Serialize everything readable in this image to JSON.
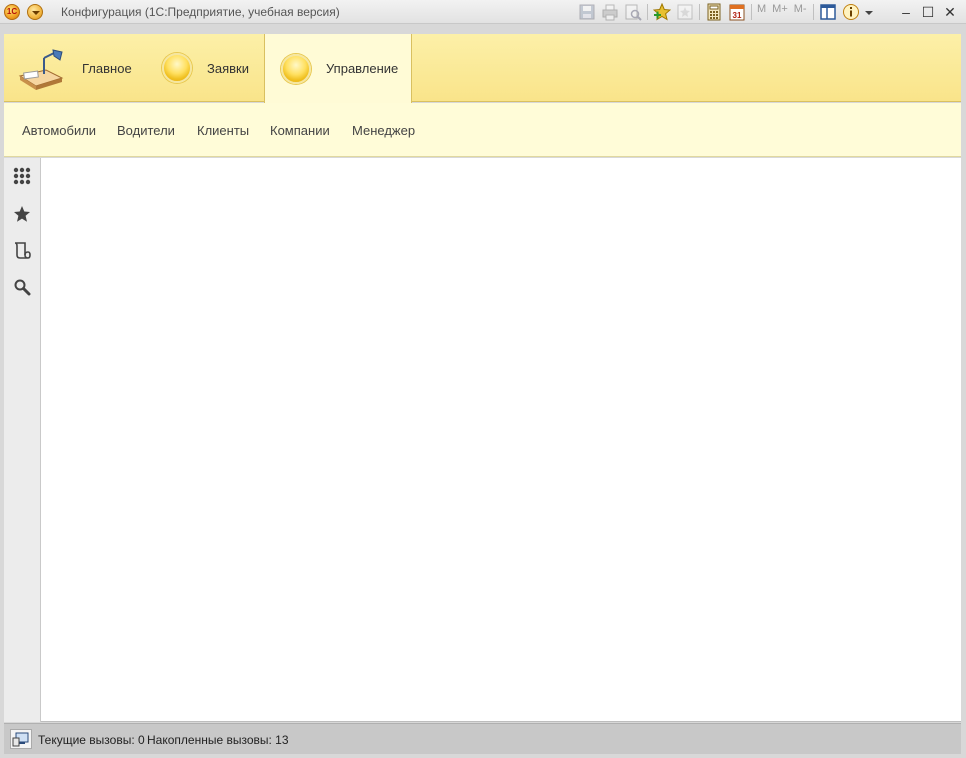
{
  "window": {
    "title": "Конфигурация  (1С:Предприятие, учебная версия)",
    "logo_text": "1С",
    "toolbar_icons": [
      "save-icon",
      "print-icon",
      "print-preview-icon",
      "add-to-favorites-icon",
      "favorites-icon",
      "calculator-icon",
      "calendar-icon",
      "memory-m-icon",
      "memory-plus-icon",
      "memory-minus-icon",
      "panels-layout-icon",
      "info-icon"
    ],
    "memory_labels": [
      "M",
      "M+",
      "M-"
    ],
    "calendar_day": "31",
    "controls": {
      "minimize": "–",
      "maximize": "☐",
      "close": "✕"
    }
  },
  "sections": [
    {
      "label": "Главное",
      "icon": "desk-lamp-icon",
      "active": false
    },
    {
      "label": "Заявки",
      "icon": "yellow-orb-icon",
      "active": false
    },
    {
      "label": "Управление",
      "icon": "yellow-orb-icon",
      "active": true
    }
  ],
  "subsection_commands": [
    "Автомобили",
    "Водители",
    "Клиенты",
    "Компании",
    "Менеджер"
  ],
  "left_panel": [
    "all-functions-icon",
    "favorites-star-icon",
    "history-icon",
    "search-icon"
  ],
  "status": {
    "current_calls": "Текущие вызовы: 0",
    "accumulated_calls": "Накопленные вызовы: 13"
  },
  "colors": {
    "sections_bg": "#f9e48a",
    "subbar_bg": "#fffcd8",
    "statusbar_bg": "#c8c8c8"
  }
}
